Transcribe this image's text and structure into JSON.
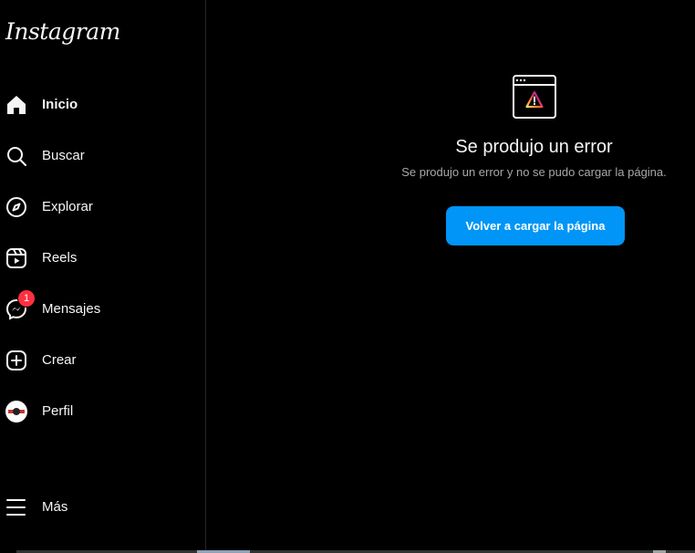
{
  "sidebar": {
    "logo_text": "Instagram",
    "items": [
      {
        "label": "Inicio",
        "icon": "home-icon"
      },
      {
        "label": "Buscar",
        "icon": "search-icon"
      },
      {
        "label": "Explorar",
        "icon": "compass-icon"
      },
      {
        "label": "Reels",
        "icon": "reels-icon"
      },
      {
        "label": "Mensajes",
        "icon": "messenger-icon",
        "badge": "1"
      },
      {
        "label": "Crear",
        "icon": "plus-square-icon"
      },
      {
        "label": "Perfil",
        "icon": "avatar"
      },
      {
        "label": "Más",
        "icon": "menu-icon"
      }
    ]
  },
  "main": {
    "error_title": "Se produjo un error",
    "error_subtitle": "Se produjo un error y no se pudo cargar la página.",
    "reload_button_label": "Volver a cargar la página"
  },
  "colors": {
    "background": "#000000",
    "text": "#f5f5f5",
    "secondary_text": "#a8a8a8",
    "button_blue": "#0095f6",
    "badge_red": "#ff3040"
  }
}
